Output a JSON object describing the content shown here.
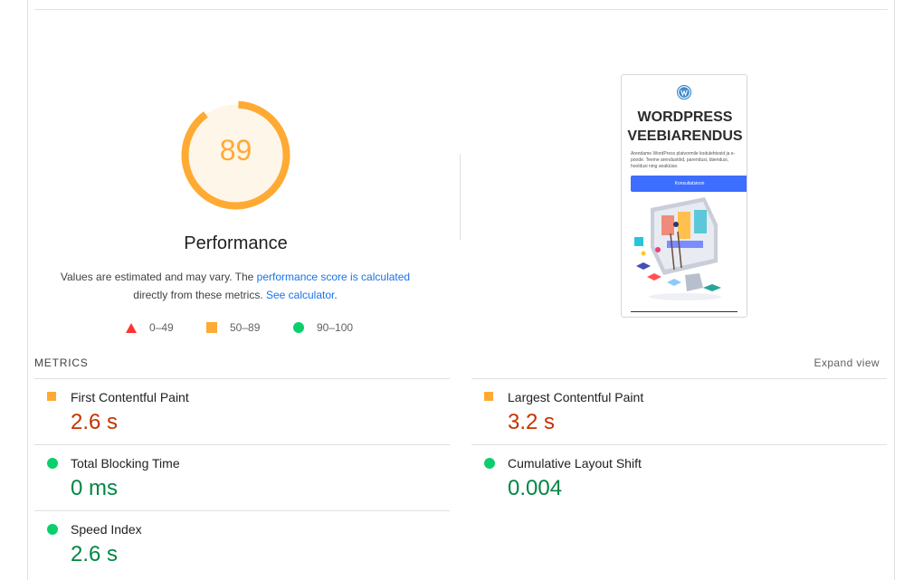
{
  "gauge": {
    "score": "89",
    "score_fraction": 0.89,
    "title": "Performance",
    "color": "#ffaa33",
    "fill": "#fff6ea"
  },
  "description": {
    "pre": "Values are estimated and may vary. The ",
    "link1": "performance score is calculated",
    "mid": "directly from these metrics. ",
    "link2": "See calculator",
    "post": "."
  },
  "legend": [
    {
      "label": "0–49",
      "icon": "red-triangle-icon",
      "color": "#ff3333"
    },
    {
      "label": "50–89",
      "icon": "orange-square-icon",
      "color": "#ffaa33"
    },
    {
      "label": "90–100",
      "icon": "green-circle-icon",
      "color": "#0cce6b"
    }
  ],
  "thumbnail": {
    "title_line1": "WORDPRESS",
    "title_line2": "VEEBIARENDUS",
    "body": "Arendame WordPress platvormile kodulehtesid ja e-poode. Teeme arendustöid, parendusi, täiendusi, hooldusi ning analüüse.",
    "button": "Konsultatsioon",
    "accent": "#3d6eff"
  },
  "metrics_section": {
    "label": "METRICS",
    "expand": "Expand view"
  },
  "metrics": [
    {
      "name": "First Contentful Paint",
      "value": "2.6 s",
      "status": "average"
    },
    {
      "name": "Largest Contentful Paint",
      "value": "3.2 s",
      "status": "average"
    },
    {
      "name": "Total Blocking Time",
      "value": "0 ms",
      "status": "pass"
    },
    {
      "name": "Cumulative Layout Shift",
      "value": "0.004",
      "status": "pass"
    },
    {
      "name": "Speed Index",
      "value": "2.6 s",
      "status": "pass"
    }
  ],
  "colors": {
    "average_value": "#c33300",
    "pass_value": "#018642",
    "average_icon": "#ffaa33",
    "pass_icon": "#0cce6b",
    "link": "#1a73e8"
  }
}
